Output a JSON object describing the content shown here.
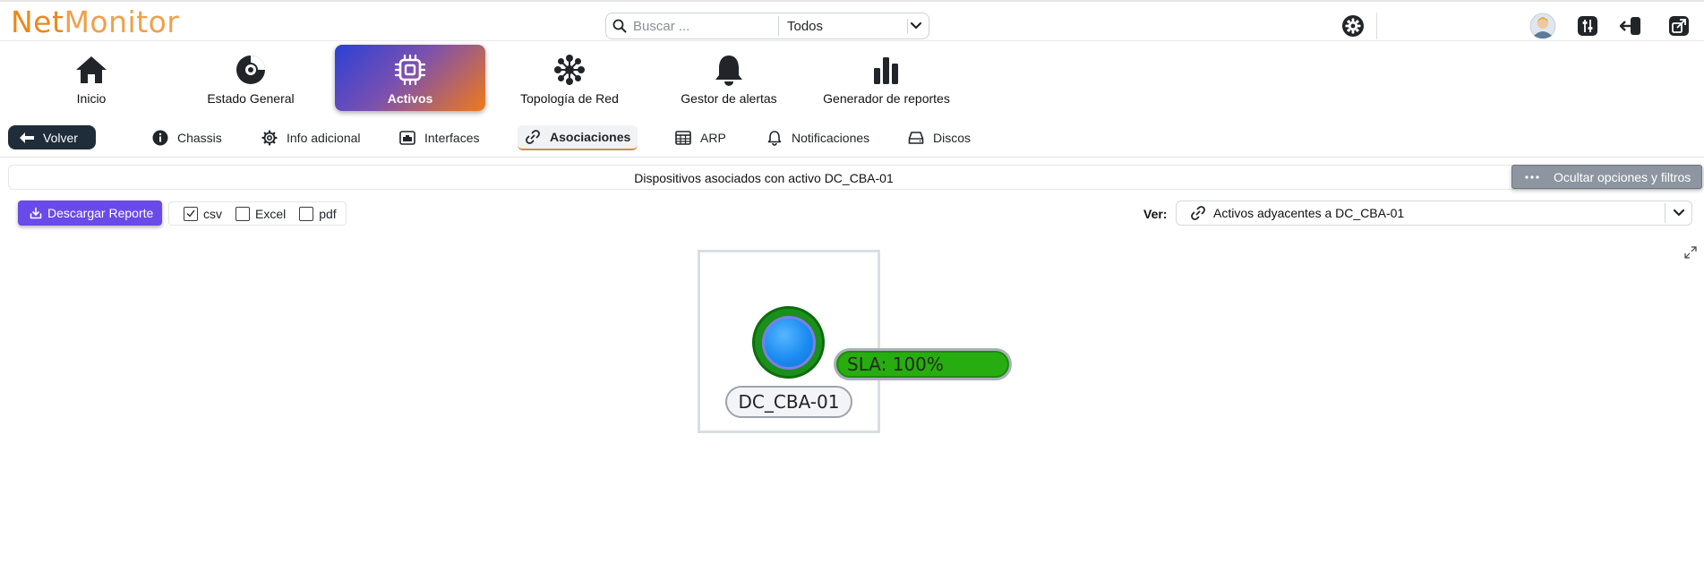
{
  "app": {
    "logo_part1": "Net",
    "logo_part2": "Monitor"
  },
  "search": {
    "placeholder": "Buscar ...",
    "scope": "Todos"
  },
  "top_icons": [
    "settings-icon",
    "user-avatar",
    "sliders-icon",
    "logout-icon",
    "external-link-icon"
  ],
  "main_nav": {
    "items": [
      {
        "label": "Inicio",
        "icon": "home-icon"
      },
      {
        "label": "Estado General",
        "icon": "gauge-icon"
      },
      {
        "label": "Activos",
        "icon": "chip-icon",
        "active": true
      },
      {
        "label": "Topología de Red",
        "icon": "network-icon"
      },
      {
        "label": "Gestor de alertas",
        "icon": "bell-icon"
      },
      {
        "label": "Generador de reportes",
        "icon": "bar-chart-icon"
      }
    ]
  },
  "sub_nav": {
    "back_label": "Volver",
    "tabs": [
      {
        "label": "Chassis",
        "icon": "info-icon"
      },
      {
        "label": "Info adicional",
        "icon": "gear-icon"
      },
      {
        "label": "Interfaces",
        "icon": "interface-icon"
      },
      {
        "label": "Asociaciones",
        "icon": "link-icon",
        "active": true
      },
      {
        "label": "ARP",
        "icon": "table-icon"
      },
      {
        "label": "Notificaciones",
        "icon": "bell-icon"
      },
      {
        "label": "Discos",
        "icon": "disk-icon"
      }
    ]
  },
  "content": {
    "title": "Dispositivos asociados con activo DC_CBA-01",
    "hide_options_label": "Ocultar opciones y filtros",
    "download_label": "Descargar Reporte",
    "formats": [
      {
        "label": "csv",
        "checked": true
      },
      {
        "label": "Excel",
        "checked": false
      },
      {
        "label": "pdf",
        "checked": false
      }
    ],
    "ver_label": "Ver:",
    "ver_value": "Activos adyacentes a DC_CBA-01"
  },
  "graph": {
    "node_name": "DC_CBA-01",
    "sla_text": "SLA: 100%",
    "sla_value": 100,
    "colors": {
      "ring": "#1b8e1b",
      "core": "#1a8cf2",
      "sla": "#27ad10"
    }
  },
  "colors": {
    "logo": "#e8891c",
    "active_gradient_start": "#2b40d6",
    "active_gradient_end": "#f07a18",
    "back_button": "#1f2d3a",
    "download_button": "#6a4ae8",
    "hide_button": "#8d96a0"
  }
}
